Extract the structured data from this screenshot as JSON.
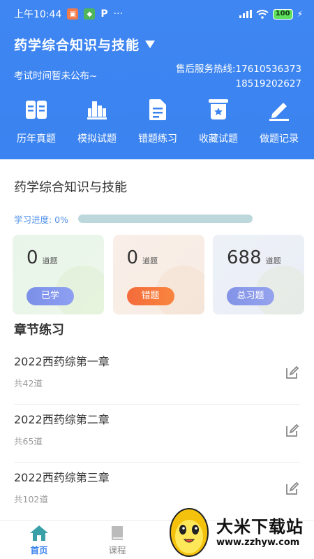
{
  "status_bar": {
    "time": "上午10:44",
    "more": "···",
    "battery": "100",
    "app_icons": [
      "app-icon-orange",
      "app-icon-green",
      "p-icon"
    ]
  },
  "header": {
    "subject": "药学综合知识与技能",
    "exam_time": "考试时间暂未公布~",
    "hotline_label": "售后服务热线:17610536373",
    "hotline_second": "18519202627"
  },
  "nav": [
    {
      "label": "历年真题",
      "icon": "book-icon"
    },
    {
      "label": "模拟试题",
      "icon": "building-icon"
    },
    {
      "label": "错题练习",
      "icon": "document-icon"
    },
    {
      "label": "收藏试题",
      "icon": "star-bookmark-icon"
    },
    {
      "label": "做题记录",
      "icon": "pencil-icon"
    }
  ],
  "main": {
    "course_title": "药学综合知识与技能",
    "progress_label": "学习进度: 0%",
    "progress": 0,
    "stats": [
      {
        "num": "0",
        "unit": "道题",
        "button": "已学"
      },
      {
        "num": "0",
        "unit": "道题",
        "button": "错题"
      },
      {
        "num": "688",
        "unit": "道题",
        "button": "总习题"
      }
    ],
    "section_title": "章节练习",
    "chapters": [
      {
        "name": "2022西药综第一章",
        "count": "共42道"
      },
      {
        "name": "2022西药综第二章",
        "count": "共65道"
      },
      {
        "name": "2022西药综第三章",
        "count": "共102道"
      }
    ]
  },
  "bottom_nav": {
    "home": "首页",
    "course": "课程"
  },
  "watermark": {
    "title": "大米下载站",
    "url": "www.zzhyw.com"
  },
  "colors": {
    "primary": "#3a83f0",
    "wrong_btn": "#f46b3b"
  }
}
